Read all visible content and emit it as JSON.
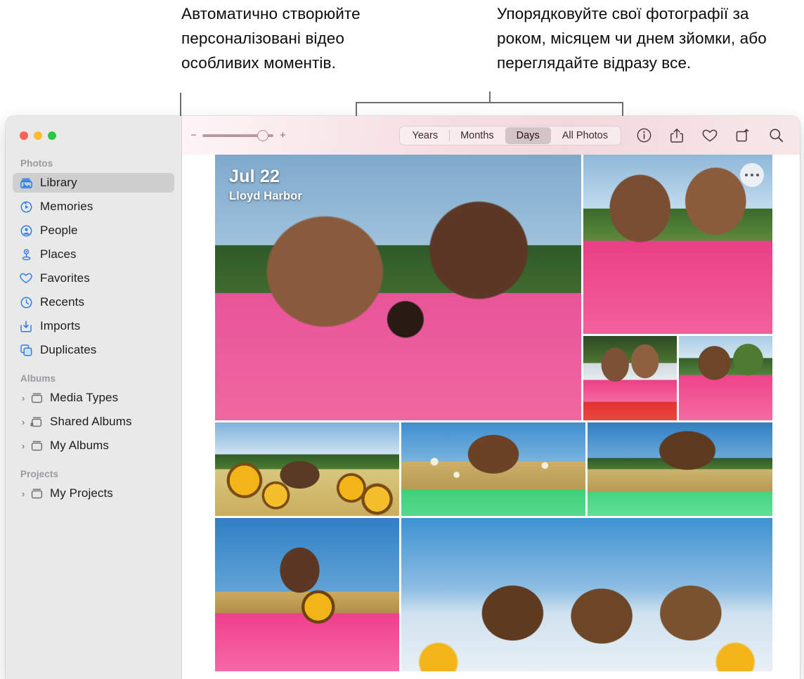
{
  "callouts": {
    "left": "Автоматично створюйте персоналізовані відео особливих моментів.",
    "right": "Упорядковуйте свої фотографії за роком, місяцем чи днем зйомки, або переглядайте відразу все."
  },
  "window": {
    "traffic_lights": {
      "close": "close-button",
      "minimize": "minimize-button",
      "maximize": "maximize-button"
    }
  },
  "sidebar": {
    "sections": [
      {
        "title": "Photos",
        "items": [
          {
            "label": "Library",
            "icon": "library-icon",
            "selected": true
          },
          {
            "label": "Memories",
            "icon": "memories-icon",
            "selected": false
          },
          {
            "label": "People",
            "icon": "people-icon",
            "selected": false
          },
          {
            "label": "Places",
            "icon": "places-icon",
            "selected": false
          },
          {
            "label": "Favorites",
            "icon": "heart-icon",
            "selected": false
          },
          {
            "label": "Recents",
            "icon": "clock-icon",
            "selected": false
          },
          {
            "label": "Imports",
            "icon": "import-icon",
            "selected": false
          },
          {
            "label": "Duplicates",
            "icon": "duplicates-icon",
            "selected": false
          }
        ]
      },
      {
        "title": "Albums",
        "items": [
          {
            "label": "Media Types",
            "icon": "album-icon",
            "disclosure": "›"
          },
          {
            "label": "Shared Albums",
            "icon": "shared-album-icon",
            "disclosure": "›"
          },
          {
            "label": "My Albums",
            "icon": "album-icon",
            "disclosure": "›"
          }
        ]
      },
      {
        "title": "Projects",
        "items": [
          {
            "label": "My Projects",
            "icon": "album-icon",
            "disclosure": "›"
          }
        ]
      }
    ]
  },
  "toolbar": {
    "zoom_out_label": "−",
    "zoom_in_label": "+",
    "zoom_value_percent": 85,
    "segments": [
      {
        "label": "Years",
        "active": false
      },
      {
        "label": "Months",
        "active": false
      },
      {
        "label": "Days",
        "active": true
      },
      {
        "label": "All Photos",
        "active": false
      }
    ],
    "buttons": [
      {
        "name": "info-icon",
        "label": "Info"
      },
      {
        "name": "share-icon",
        "label": "Share"
      },
      {
        "name": "favorite-icon",
        "label": "Favorite"
      },
      {
        "name": "rotate-icon",
        "label": "Rotate"
      },
      {
        "name": "search-icon",
        "label": "Search"
      }
    ]
  },
  "grid": {
    "date_title": "Jul 22",
    "date_location": "Lloyd Harbor",
    "more_button_label": "More options",
    "photos": [
      {
        "name": "photo-three-friends-park",
        "style": "p-group1"
      },
      {
        "name": "photo-selfie-three-top",
        "style": "p-sel-right"
      },
      {
        "name": "photo-two-friends-selfie",
        "style": "p-two"
      },
      {
        "name": "photo-pair-green-red",
        "style": "p-pair"
      },
      {
        "name": "photo-sunflowers-group",
        "style": "p-sunflowers"
      },
      {
        "name": "photo-field-portrait",
        "style": "p-field-portrait"
      },
      {
        "name": "photo-green-dress-field",
        "style": "p-green-field"
      },
      {
        "name": "photo-pink-sunflower-selfie",
        "style": "p-pink-sunflower"
      },
      {
        "name": "photo-sky-three-friends",
        "style": "p-sky-three"
      }
    ]
  },
  "colors": {
    "accent_blue": "#2f7fe8",
    "sidebar_bg": "#e9e9e9",
    "selected_row": "#cfcfcf",
    "toolbar_pink": "#f2d9dd",
    "callout_line": "#6e6e6e"
  }
}
